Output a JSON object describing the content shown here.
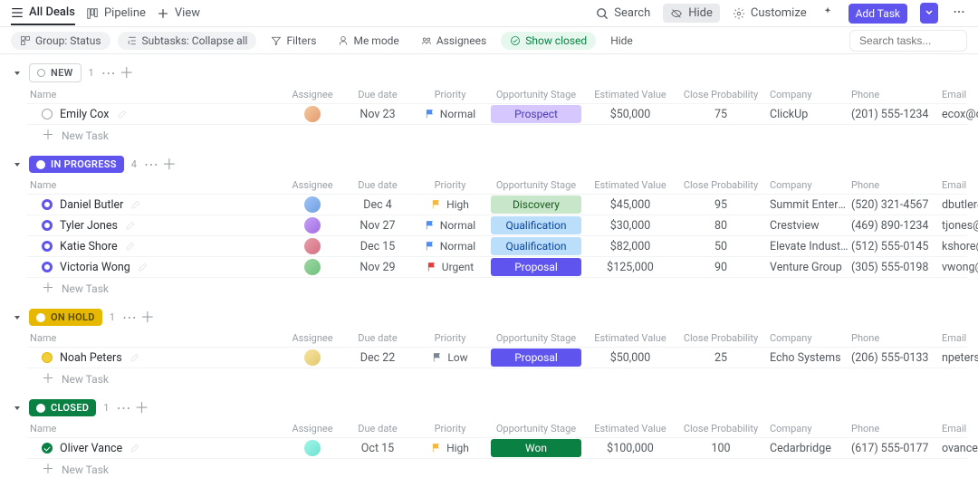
{
  "topbar": {
    "tabs": [
      {
        "label": "All Deals",
        "icon": "list"
      },
      {
        "label": "Pipeline",
        "icon": "board"
      },
      {
        "label": "View",
        "icon": "plus"
      }
    ],
    "search_label": "Search",
    "hide_label": "Hide",
    "customize_label": "Customize",
    "add_task_label": "Add Task"
  },
  "toolbar": {
    "group_label": "Group: Status",
    "subtasks_label": "Subtasks: Collapse all",
    "filters_label": "Filters",
    "me_mode_label": "Me mode",
    "assignees_label": "Assignees",
    "show_closed_label": "Show closed",
    "hide_label": "Hide",
    "search_placeholder": "Search tasks..."
  },
  "columns": {
    "name": "Name",
    "assignee": "Assignee",
    "due": "Due date",
    "priority": "Priority",
    "stage": "Opportunity Stage",
    "est": "Estimated Value",
    "prob": "Close Probability",
    "company": "Company",
    "phone": "Phone",
    "email": "Email"
  },
  "new_task_label": "New Task",
  "groups": [
    {
      "key": "new",
      "label": "NEW",
      "count": "1",
      "status_class": "status-new",
      "row_icon": "si-new",
      "rows": [
        {
          "name": "Emily Cox",
          "avatar": "av-1",
          "due": "Nov 23",
          "priority": {
            "label": "Normal",
            "color": "#4f8df6"
          },
          "stage": {
            "label": "Prospect",
            "class": "stage-prospect"
          },
          "est": "$50,000",
          "prob": "75",
          "company": "ClickUp",
          "phone": "(201) 555-1234",
          "email": "ecox@cli"
        }
      ]
    },
    {
      "key": "inprogress",
      "label": "IN PROGRESS",
      "count": "4",
      "status_class": "status-inprogress",
      "row_icon": "si-inprogress",
      "rows": [
        {
          "name": "Daniel Butler",
          "avatar": "av-2",
          "due": "Dec 4",
          "priority": {
            "label": "High",
            "color": "#f3b93c"
          },
          "stage": {
            "label": "Discovery",
            "class": "stage-discovery"
          },
          "est": "$45,000",
          "prob": "95",
          "company": "Summit Enterpri...",
          "phone": "(520) 321-4567",
          "email": "dbutler@"
        },
        {
          "name": "Tyler Jones",
          "avatar": "av-3",
          "due": "Nov 27",
          "priority": {
            "label": "Normal",
            "color": "#4f8df6"
          },
          "stage": {
            "label": "Qualification",
            "class": "stage-qualification"
          },
          "est": "$30,000",
          "prob": "80",
          "company": "Crestview",
          "phone": "(469) 890-1234",
          "email": "tjones@c"
        },
        {
          "name": "Katie Shore",
          "avatar": "av-4",
          "due": "Dec 15",
          "priority": {
            "label": "Normal",
            "color": "#4f8df6"
          },
          "stage": {
            "label": "Qualification",
            "class": "stage-qualification"
          },
          "est": "$82,000",
          "prob": "50",
          "company": "Elevate Industrial",
          "phone": "(512) 555-0145",
          "email": "kshore@"
        },
        {
          "name": "Victoria Wong",
          "avatar": "av-5",
          "due": "Nov 29",
          "priority": {
            "label": "Urgent",
            "color": "#e13d3d"
          },
          "stage": {
            "label": "Proposal",
            "class": "stage-proposal"
          },
          "est": "$125,000",
          "prob": "90",
          "company": "Venture Group",
          "phone": "(305) 555-0198",
          "email": "vwong@"
        }
      ]
    },
    {
      "key": "onhold",
      "label": "ON HOLD",
      "count": "1",
      "status_class": "status-onhold",
      "row_icon": "si-onhold",
      "rows": [
        {
          "name": "Noah Peters",
          "avatar": "av-6",
          "due": "Dec 22",
          "priority": {
            "label": "Low",
            "color": "#7b8794"
          },
          "stage": {
            "label": "Proposal",
            "class": "stage-proposal"
          },
          "est": "$50,000",
          "prob": "25",
          "company": "Echo Systems",
          "phone": "(206) 555-0133",
          "email": "npeters@"
        }
      ]
    },
    {
      "key": "closed",
      "label": "CLOSED",
      "count": "1",
      "status_class": "status-closed",
      "row_icon": "si-closed",
      "rows": [
        {
          "name": "Oliver Vance",
          "avatar": "av-7",
          "due": "Oct 15",
          "priority": {
            "label": "High",
            "color": "#f3b93c"
          },
          "stage": {
            "label": "Won",
            "class": "stage-won"
          },
          "est": "$100,000",
          "prob": "100",
          "company": "Cedarbridge",
          "phone": "(617) 555-0177",
          "email": "ovance@"
        }
      ]
    }
  ]
}
